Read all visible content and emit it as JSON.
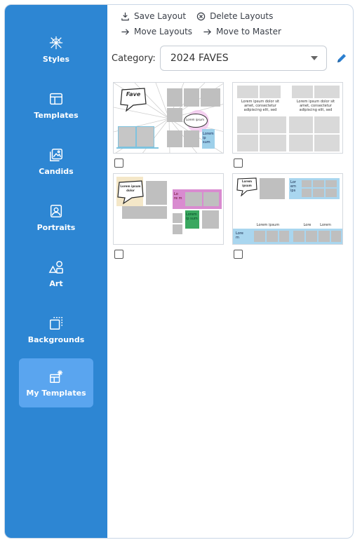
{
  "sidebar": {
    "items": [
      {
        "label": "Styles",
        "icon": "styles-icon"
      },
      {
        "label": "Templates",
        "icon": "templates-icon"
      },
      {
        "label": "Candids",
        "icon": "candids-icon"
      },
      {
        "label": "Portraits",
        "icon": "portraits-icon"
      },
      {
        "label": "Art",
        "icon": "art-icon"
      },
      {
        "label": "Backgrounds",
        "icon": "backgrounds-icon"
      },
      {
        "label": "My Templates",
        "icon": "my-templates-icon",
        "active": true
      }
    ]
  },
  "toolbar": {
    "save_layout": "Save Layout",
    "delete_layouts": "Delete Layouts",
    "move_layouts": "Move Layouts",
    "move_to_master": "Move to Master"
  },
  "category": {
    "label": "Category:",
    "selected": "2024 FAVES"
  },
  "layouts": [
    {
      "bubble": "Fave",
      "small_bubble": "Lorem ipsum",
      "side_text": "Lorem ip sum"
    },
    {
      "text_left": "Lorem ipsum dolor sit amet, consectetur adipiscing elit, sed",
      "text_right": "Lorem ipsum dolor sit amet, consectetur adipiscing elit, sed"
    },
    {
      "bubble": "Lorem ipsum dolor",
      "pink_text": "Lo re m",
      "green_text": "Lorem ip sum"
    },
    {
      "bubble": "Lorem ipsum",
      "blue_text": "Lor em ips",
      "caption_1": "Lorem ipsum",
      "caption_2": "Lore",
      "caption_3": "Lorem",
      "bottom_text": "Lore m"
    }
  ],
  "colors": {
    "sidebar": "#2d86d3",
    "active_item": "#5aa5ef",
    "accent": "#2b7fd0"
  }
}
